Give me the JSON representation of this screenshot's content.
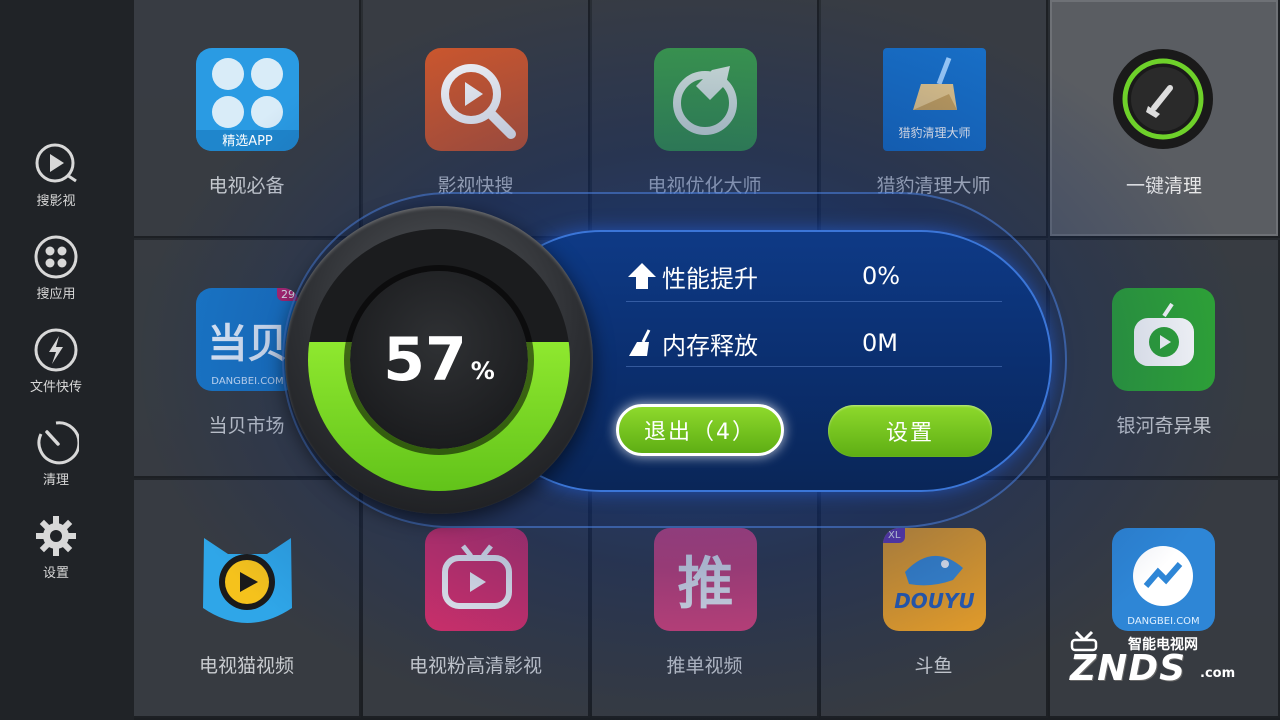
{
  "sidebar": {
    "items": [
      {
        "label": "搜影视",
        "icon": "play-search-icon"
      },
      {
        "label": "搜应用",
        "icon": "apps-grid-icon"
      },
      {
        "label": "文件快传",
        "icon": "lightning-icon"
      },
      {
        "label": "清理",
        "icon": "clean-dial-icon"
      },
      {
        "label": "设置",
        "icon": "gear-icon"
      }
    ]
  },
  "apps": {
    "row1": [
      {
        "name": "电视必备",
        "badge": "精选APP"
      },
      {
        "name": "影视快搜"
      },
      {
        "name": "电视优化大师"
      },
      {
        "name": "猎豹清理大师",
        "badge": "猎豹清理大师"
      },
      {
        "name": "一键清理"
      }
    ],
    "row2": [
      {
        "name": "当贝市场",
        "badge": "DANGBEI.COM",
        "corner": "29"
      },
      {
        "name": ""
      },
      {
        "name": ""
      },
      {
        "name": ""
      },
      {
        "name": "银河奇异果"
      }
    ],
    "row3": [
      {
        "name": "电视猫视频"
      },
      {
        "name": "电视粉高清影视"
      },
      {
        "name": "推单视频"
      },
      {
        "name": "斗鱼",
        "badge": "DOUYU",
        "corner": "XL"
      },
      {
        "name": "",
        "badge": "DANGBEI.COM"
      }
    ]
  },
  "popup": {
    "percent": "57",
    "percent_unit": "%",
    "fill_fraction": 0.57,
    "stats": [
      {
        "label": "性能提升",
        "value": "0%",
        "icon": "arrow-up-icon"
      },
      {
        "label": "内存释放",
        "value": "0M",
        "icon": "broom-icon"
      }
    ],
    "exit_button": "退出（4）",
    "settings_button": "设置"
  },
  "watermark": {
    "top": "智能电视网",
    "main": "ZNDS",
    "suffix": ".com"
  },
  "colors": {
    "accent_green": "#6cc41c",
    "panel_blue": "#0e3a86"
  }
}
